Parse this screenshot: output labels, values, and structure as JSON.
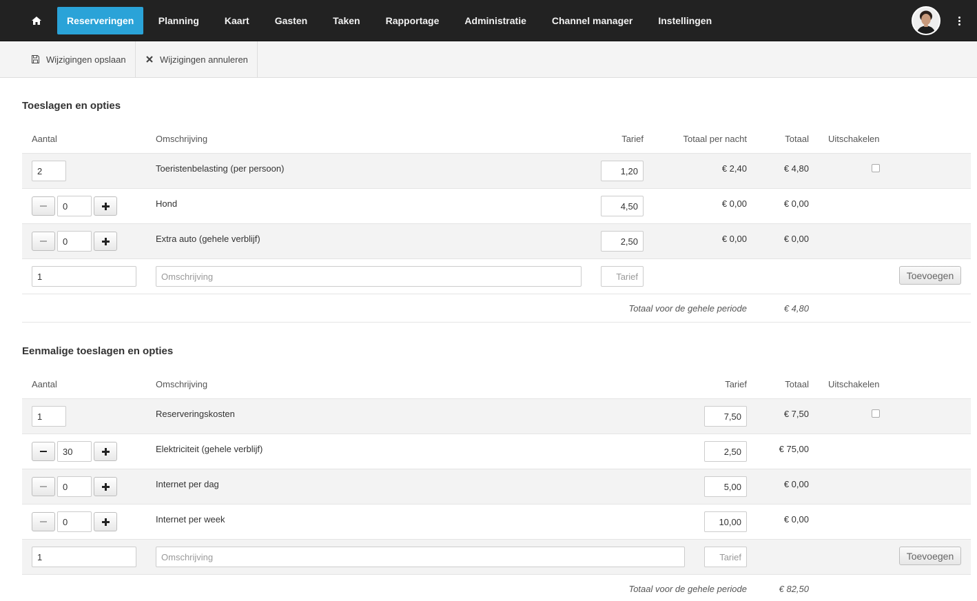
{
  "nav": {
    "items": [
      "Reserveringen",
      "Planning",
      "Kaart",
      "Gasten",
      "Taken",
      "Rapportage",
      "Administratie",
      "Channel manager",
      "Instellingen"
    ],
    "active_index": 0,
    "accent": "#2aa3d8"
  },
  "toolbar": {
    "save_label": "Wijzigingen opslaan",
    "cancel_label": "Wijzigingen annuleren"
  },
  "section1": {
    "title": "Toeslagen en opties",
    "headers": {
      "aantal": "Aantal",
      "omschrijving": "Omschrijving",
      "tarief": "Tarief",
      "totaal_per_nacht": "Totaal per nacht",
      "totaal": "Totaal",
      "uitschakelen": "Uitschakelen"
    },
    "rows": [
      {
        "qty": "2",
        "desc": "Toeristenbelasting (per persoon)",
        "rate": "1,20",
        "per_night": "€ 2,40",
        "total": "€ 4,80",
        "stepper": false,
        "checkbox": true
      },
      {
        "qty": "0",
        "desc": "Hond",
        "rate": "4,50",
        "per_night": "€ 0,00",
        "total": "€ 0,00",
        "stepper": true,
        "checkbox": false
      },
      {
        "qty": "0",
        "desc": "Extra auto (gehele verblijf)",
        "rate": "2,50",
        "per_night": "€ 0,00",
        "total": "€ 0,00",
        "stepper": true,
        "checkbox": false
      }
    ],
    "new_row": {
      "qty": "1",
      "desc_placeholder": "Omschrijving",
      "rate_placeholder": "Tarief",
      "add_label": "Toevoegen"
    },
    "total_label": "Totaal voor de gehele periode",
    "total_value": "€ 4,80"
  },
  "section2": {
    "title": "Eenmalige toeslagen en opties",
    "headers": {
      "aantal": "Aantal",
      "omschrijving": "Omschrijving",
      "tarief": "Tarief",
      "totaal": "Totaal",
      "uitschakelen": "Uitschakelen"
    },
    "rows": [
      {
        "qty": "1",
        "desc": "Reserveringskosten",
        "rate": "7,50",
        "total": "€ 7,50",
        "stepper": false,
        "checkbox": true
      },
      {
        "qty": "30",
        "desc": "Elektriciteit (gehele verblijf)",
        "rate": "2,50",
        "total": "€ 75,00",
        "stepper": true,
        "checkbox": false
      },
      {
        "qty": "0",
        "desc": "Internet per dag",
        "rate": "5,00",
        "total": "€ 0,00",
        "stepper": true,
        "checkbox": false
      },
      {
        "qty": "0",
        "desc": "Internet per week",
        "rate": "10,00",
        "total": "€ 0,00",
        "stepper": true,
        "checkbox": false
      }
    ],
    "new_row": {
      "qty": "1",
      "desc_placeholder": "Omschrijving",
      "rate_placeholder": "Tarief",
      "add_label": "Toevoegen"
    },
    "total_label": "Totaal voor de gehele periode",
    "total_value": "€ 82,50"
  }
}
